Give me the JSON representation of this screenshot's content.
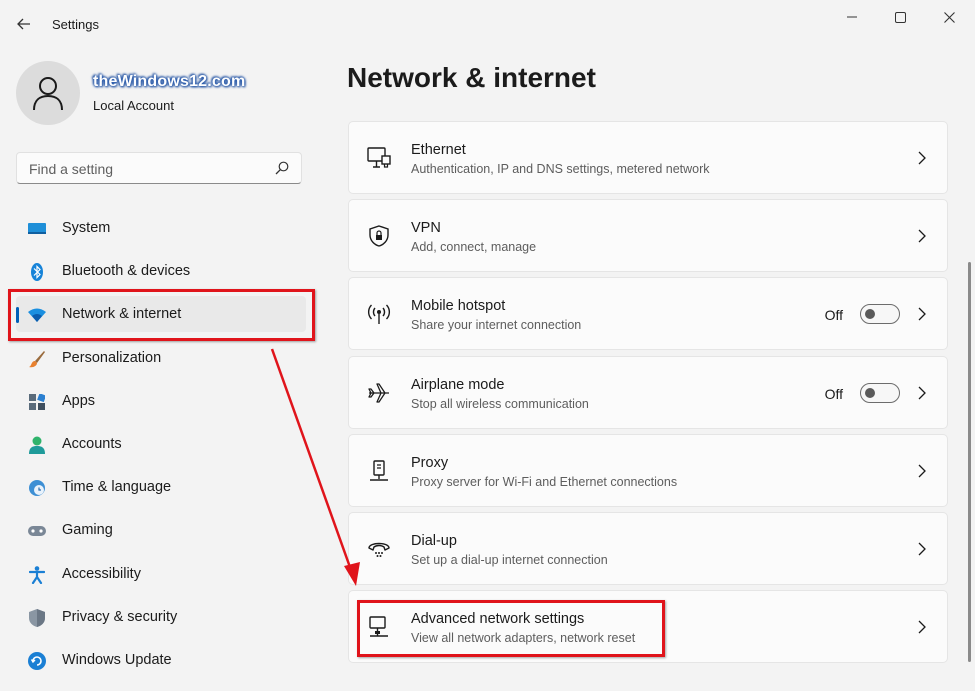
{
  "window": {
    "title": "Settings",
    "controls": {
      "minimize": "—",
      "maximize": "☐",
      "close": "✕"
    }
  },
  "account": {
    "name": "theWindows12.com",
    "type": "Local Account"
  },
  "search": {
    "placeholder": "Find a setting"
  },
  "sidebar": {
    "items": [
      {
        "label": "System",
        "icon": "monitor-icon"
      },
      {
        "label": "Bluetooth & devices",
        "icon": "bluetooth-icon"
      },
      {
        "label": "Network & internet",
        "icon": "wifi-icon",
        "selected": true
      },
      {
        "label": "Personalization",
        "icon": "brush-icon"
      },
      {
        "label": "Apps",
        "icon": "apps-icon"
      },
      {
        "label": "Accounts",
        "icon": "person-icon"
      },
      {
        "label": "Time & language",
        "icon": "globe-clock-icon"
      },
      {
        "label": "Gaming",
        "icon": "gamepad-icon"
      },
      {
        "label": "Accessibility",
        "icon": "accessibility-icon"
      },
      {
        "label": "Privacy & security",
        "icon": "shield-icon"
      },
      {
        "label": "Windows Update",
        "icon": "update-icon"
      }
    ]
  },
  "main": {
    "title": "Network & internet",
    "cards": [
      {
        "title": "Ethernet",
        "subtitle": "Authentication, IP and DNS settings, metered network",
        "icon": "ethernet-icon"
      },
      {
        "title": "VPN",
        "subtitle": "Add, connect, manage",
        "icon": "vpn-shield-icon"
      },
      {
        "title": "Mobile hotspot",
        "subtitle": "Share your internet connection",
        "icon": "hotspot-icon",
        "toggle": "Off"
      },
      {
        "title": "Airplane mode",
        "subtitle": "Stop all wireless communication",
        "icon": "airplane-icon",
        "toggle": "Off"
      },
      {
        "title": "Proxy",
        "subtitle": "Proxy server for Wi-Fi and Ethernet connections",
        "icon": "proxy-icon"
      },
      {
        "title": "Dial-up",
        "subtitle": "Set up a dial-up internet connection",
        "icon": "dialup-icon"
      },
      {
        "title": "Advanced network settings",
        "subtitle": "View all network adapters, network reset",
        "icon": "network-adapter-icon"
      }
    ]
  },
  "colors": {
    "accent": "#005fb8",
    "annotation": "#e0141b",
    "background": "#f3f3f3",
    "card": "#fbfbfb"
  }
}
